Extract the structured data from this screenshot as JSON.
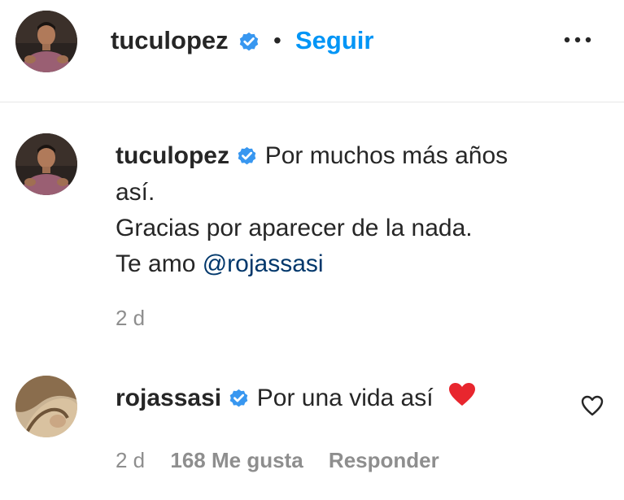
{
  "header": {
    "username": "tuculopez",
    "separator": "•",
    "follow_label": "Seguir",
    "verified_icon": "verified-badge-icon",
    "more_icon": "more-options-icon"
  },
  "comments": [
    {
      "username": "tuculopez",
      "verified": true,
      "text_parts": [
        "Por muchos más años",
        "así.",
        "Gracias por aparecer de la nada.",
        "Te amo "
      ],
      "mention": "@rojassasi",
      "time": "2 d"
    },
    {
      "username": "rojassasi",
      "verified": true,
      "text": "Por una vida así",
      "emoji": "red-heart-emoji",
      "time": "2 d",
      "likes": "168 Me gusta",
      "reply_label": "Responder",
      "like_icon": "heart-outline-icon"
    }
  ],
  "colors": {
    "text": "#262626",
    "link": "#0095f6",
    "mention": "#00376b",
    "meta": "#8e8e8e",
    "verified": "#3897f0",
    "heart": "#e8262e",
    "divider": "#e6e6e6"
  }
}
